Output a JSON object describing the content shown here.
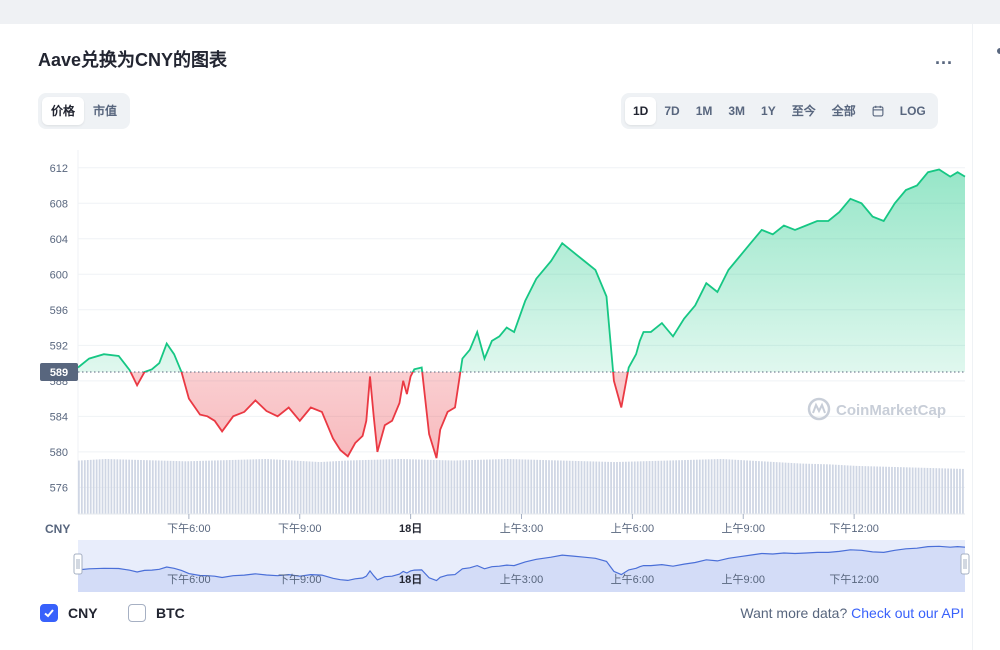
{
  "header": {
    "title": "Aave兑换为CNY的图表",
    "more_label": "..."
  },
  "tabs_left": [
    {
      "label": "价格",
      "active": true
    },
    {
      "label": "市值",
      "active": false
    }
  ],
  "tabs_right": [
    {
      "label": "1D",
      "active": true
    },
    {
      "label": "7D",
      "active": false
    },
    {
      "label": "1M",
      "active": false
    },
    {
      "label": "3M",
      "active": false
    },
    {
      "label": "1Y",
      "active": false
    },
    {
      "label": "至今",
      "active": false
    },
    {
      "label": "全部",
      "active": false
    }
  ],
  "calendar_icon": "calendar-icon",
  "log_label": "LOG",
  "footer": {
    "currencies": [
      {
        "label": "CNY",
        "checked": true
      },
      {
        "label": "BTC",
        "checked": false
      }
    ],
    "api_text": "Want more data?",
    "api_link": "Check out our API"
  },
  "colors": {
    "up": "#16c784",
    "down": "#ea3943",
    "accent": "#3861fb",
    "volume": "#cfd6e4"
  },
  "chart_data": {
    "type": "line",
    "ylabel": "CNY",
    "ylim": [
      573,
      614
    ],
    "yticks": [
      576,
      580,
      584,
      588,
      592,
      596,
      600,
      604,
      608,
      612
    ],
    "reference_value": 589,
    "reference_label": "589",
    "xlim": [
      0,
      24
    ],
    "xticks": [
      {
        "x": 3,
        "label": "下午6:00",
        "bold": false
      },
      {
        "x": 6,
        "label": "下午9:00",
        "bold": false
      },
      {
        "x": 9,
        "label": "18日",
        "bold": true
      },
      {
        "x": 12,
        "label": "上午3:00",
        "bold": false
      },
      {
        "x": 15,
        "label": "上午6:00",
        "bold": false
      },
      {
        "x": 18,
        "label": "上午9:00",
        "bold": false
      },
      {
        "x": 21,
        "label": "下午12:00",
        "bold": false
      }
    ],
    "watermark": "CoinMarketCap",
    "series": [
      {
        "x": [
          0,
          0.3,
          0.7,
          1.1,
          1.4,
          1.6,
          1.8,
          2.0,
          2.2,
          2.4,
          2.6,
          2.8,
          3.0,
          3.3,
          3.5,
          3.7,
          3.9,
          4.2,
          4.5,
          4.8,
          5.1,
          5.4,
          5.7,
          6.0,
          6.3,
          6.6,
          6.9,
          7.1,
          7.3,
          7.5,
          7.7,
          7.8,
          7.9,
          8.0,
          8.1,
          8.3,
          8.5,
          8.7,
          8.8,
          8.9,
          9.0,
          9.1,
          9.3,
          9.5,
          9.7,
          9.8,
          10.0,
          10.2,
          10.4,
          10.6,
          10.8,
          11.0,
          11.2,
          11.4,
          11.6,
          11.8,
          12.1,
          12.4,
          12.8,
          13.1,
          13.4,
          13.7,
          14.0,
          14.3,
          14.5,
          14.7,
          14.9,
          15.1,
          15.2,
          15.3,
          15.5,
          15.8,
          16.1,
          16.4,
          16.7,
          17.0,
          17.3,
          17.6,
          17.9,
          18.2,
          18.5,
          18.8,
          19.1,
          19.4,
          19.7,
          20.0,
          20.3,
          20.6,
          20.9,
          21.2,
          21.5,
          21.8,
          22.1,
          22.4,
          22.7,
          23.0,
          23.3,
          23.6,
          23.8,
          24.0
        ],
        "y": [
          589.5,
          590.5,
          591.0,
          590.8,
          589.2,
          587.5,
          589.0,
          589.3,
          590.0,
          592.2,
          591.0,
          589.0,
          586.0,
          584.2,
          584.0,
          583.5,
          582.3,
          584.0,
          584.5,
          585.8,
          584.6,
          584.0,
          585.0,
          583.5,
          585.0,
          584.5,
          581.5,
          580.2,
          579.5,
          581.0,
          581.8,
          583.5,
          588.5,
          584.0,
          580.0,
          583.0,
          583.5,
          585.5,
          588.0,
          586.5,
          588.5,
          589.3,
          589.5,
          582.0,
          579.3,
          582.5,
          584.5,
          585.0,
          590.5,
          591.5,
          593.5,
          590.5,
          592.5,
          593.0,
          594.0,
          593.5,
          597.0,
          599.5,
          601.5,
          603.5,
          602.5,
          601.5,
          600.5,
          597.5,
          588.0,
          585.0,
          589.5,
          591.0,
          592.5,
          593.5,
          593.5,
          594.5,
          593.0,
          595.0,
          596.5,
          599.0,
          598.0,
          600.5,
          602.0,
          603.5,
          605.0,
          604.5,
          605.5,
          605.0,
          605.5,
          606.0,
          606.0,
          607.0,
          608.5,
          608.0,
          606.5,
          606.0,
          608.0,
          609.5,
          610.0,
          611.5,
          611.8,
          611.0,
          611.5,
          611.0
        ]
      }
    ],
    "volume": [
      7,
      7.2,
      7.1,
      7,
      6.9,
      7,
      7.1,
      7.2,
      7,
      6.8,
      7,
      7.1,
      7.2,
      7.1,
      7,
      7.1,
      7.2,
      7.1,
      7,
      6.9,
      6.8,
      6.9,
      7,
      7.1,
      7.2,
      7,
      6.8,
      6.6,
      6.5,
      6.3,
      6.2,
      6.1,
      6,
      5.9
    ]
  }
}
